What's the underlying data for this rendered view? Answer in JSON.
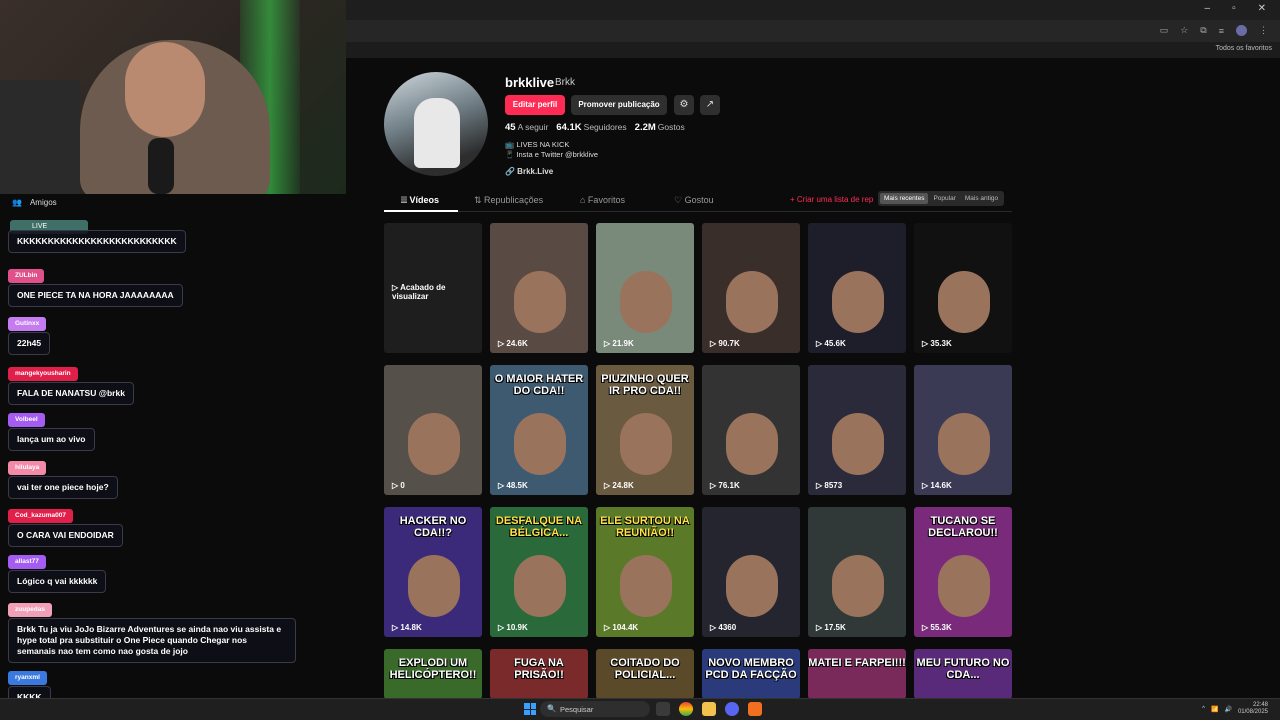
{
  "window_controls": [
    "–",
    "▫",
    "✕"
  ],
  "bookmarks": {
    "all_label": "Todos os favoritos"
  },
  "friends": {
    "label": "Amigos"
  },
  "live": {
    "label": "LIVE"
  },
  "chat": [
    {
      "user": "",
      "text": "KKKKKKKKKKKKKKKKKKKKKKKKKK",
      "color": "#2c6b60"
    },
    {
      "user": "ZULbin",
      "text": "ONE PIECE TA NA HORA JAAAAAAAA",
      "color": "#e0508a"
    },
    {
      "user": "Gutinxx",
      "text": "22h45",
      "color": "#c47cf0"
    },
    {
      "user": "mangekyousharin",
      "text": "FALA DE NANATSU @brkk",
      "color": "#e0204a"
    },
    {
      "user": "Volbeel",
      "text": "lança um ao vivo",
      "color": "#a55cf0"
    },
    {
      "user": "hilulaya",
      "text": "vai ter one piece hoje?",
      "color": "#f28aa8"
    },
    {
      "user": "Cod_kazuma007",
      "text": "O CARA VAI ENDOIDAR",
      "color": "#e0204a"
    },
    {
      "user": "allast77",
      "text": "Lógico q vai kkkkkk",
      "color": "#a55cf0"
    },
    {
      "user": "zuupedas",
      "text": "Brkk Tu ja viu JoJo Bizarre Adventures se ainda nao viu assista e hype total pra substituir o One Piece quando Chegar nos semanais nao tem como nao gosta de jojo",
      "color": "#f2a0b8"
    },
    {
      "user": "ryanxml",
      "text": "KKKK",
      "color": "#3a7ae0"
    }
  ],
  "profile": {
    "username": "brkklive",
    "nickname": "Brkk",
    "edit_label": "Editar perfil",
    "promote_label": "Promover publicação",
    "following_count": "45",
    "following_label": "A seguir",
    "followers_count": "64.1K",
    "followers_label": "Seguidores",
    "likes_count": "2.2M",
    "likes_label": "Gostos",
    "bio_line1": "📺 LIVES NA KICK",
    "bio_line2": "📱 Insta e Twitter @brkklive",
    "link": "🔗 Brkk.Live"
  },
  "tabs": {
    "videos": "⦙⦙⦙ Vídeos",
    "reposts": "⇅ Republicações",
    "favorites": "⌂ Favoritos",
    "liked": "♡ Gostou",
    "create_list": "+ Criar uma lista de rep",
    "sort_recent": "Mais recentes",
    "sort_popular": "Popular",
    "sort_oldest": "Mais antigo"
  },
  "videos": [
    {
      "views": "",
      "caption": "",
      "overlay": "▷ Acabado de visualizar",
      "bg": "#1e1e1e"
    },
    {
      "views": "▷ 24.6K",
      "caption": "",
      "overlay": "",
      "bg": "#5a4a44"
    },
    {
      "views": "▷ 21.9K",
      "caption": "",
      "overlay": "",
      "bg": "#7a8a7a"
    },
    {
      "views": "▷ 90.7K",
      "caption": "",
      "overlay": "",
      "bg": "#3a2e2a"
    },
    {
      "views": "▷ 45.6K",
      "caption": "",
      "overlay": "",
      "bg": "#1e1e2a"
    },
    {
      "views": "▷ 35.3K",
      "caption": "",
      "overlay": "",
      "bg": "#111111"
    },
    {
      "views": "▷ 0",
      "caption": "",
      "overlay": "",
      "bg": "#55504a"
    },
    {
      "views": "▷ 48.5K",
      "caption": "O MAIOR HATER DO CDA!!",
      "overlay": "",
      "bg": "#3d5a70"
    },
    {
      "views": "▷ 24.8K",
      "caption": "PIUZINHO QUER IR PRO CDA!!",
      "overlay": "",
      "bg": "#6a5a40"
    },
    {
      "views": "▷ 76.1K",
      "caption": "",
      "overlay": "",
      "bg": "#333333"
    },
    {
      "views": "▷ 8573",
      "caption": "",
      "overlay": "",
      "bg": "#2a2a3a"
    },
    {
      "views": "▷ 14.6K",
      "caption": "",
      "overlay": "",
      "bg": "#3a3a55"
    },
    {
      "views": "▷ 14.8K",
      "caption": "HACKER NO CDA!!?",
      "overlay": "",
      "bg": "#3b2a7a"
    },
    {
      "views": "▷ 10.9K",
      "caption": "DESFALQUE NA BÉLGICA...",
      "overlay": "",
      "bg": "#2a6a3a"
    },
    {
      "views": "▷ 104.4K",
      "caption": "ELE SURTOU NA REUNIÃO!!",
      "overlay": "",
      "bg": "#5a7a2a"
    },
    {
      "views": "▷ 4360",
      "caption": "",
      "overlay": "",
      "bg": "#252530"
    },
    {
      "views": "▷ 17.5K",
      "caption": "",
      "overlay": "",
      "bg": "#303838"
    },
    {
      "views": "▷ 55.3K",
      "caption": "TUCANO SE DECLAROU!!",
      "overlay": "",
      "bg": "#7a2a7a"
    },
    {
      "views": "",
      "caption": "EXPLODI UM HELICÓPTERO!!",
      "overlay": "",
      "bg": "#3a6a2a"
    },
    {
      "views": "",
      "caption": "FUGA NA PRISÃO!!",
      "overlay": "",
      "bg": "#7a2a2a"
    },
    {
      "views": "",
      "caption": "COITADO DO POLICIAL...",
      "overlay": "",
      "bg": "#5a4a2a"
    },
    {
      "views": "",
      "caption": "NOVO MEMBRO PCD DA FACÇÃO",
      "overlay": "",
      "bg": "#2a3a7a"
    },
    {
      "views": "",
      "caption": "MATEI E FARPEI!!!",
      "overlay": "",
      "bg": "#7a2a5a"
    },
    {
      "views": "",
      "caption": "MEU FUTURO NO CDA...",
      "overlay": "",
      "bg": "#5a2a7a"
    }
  ],
  "taskbar": {
    "search_placeholder": "Pesquisar",
    "time": "22:48",
    "date": "01/08/2025"
  }
}
